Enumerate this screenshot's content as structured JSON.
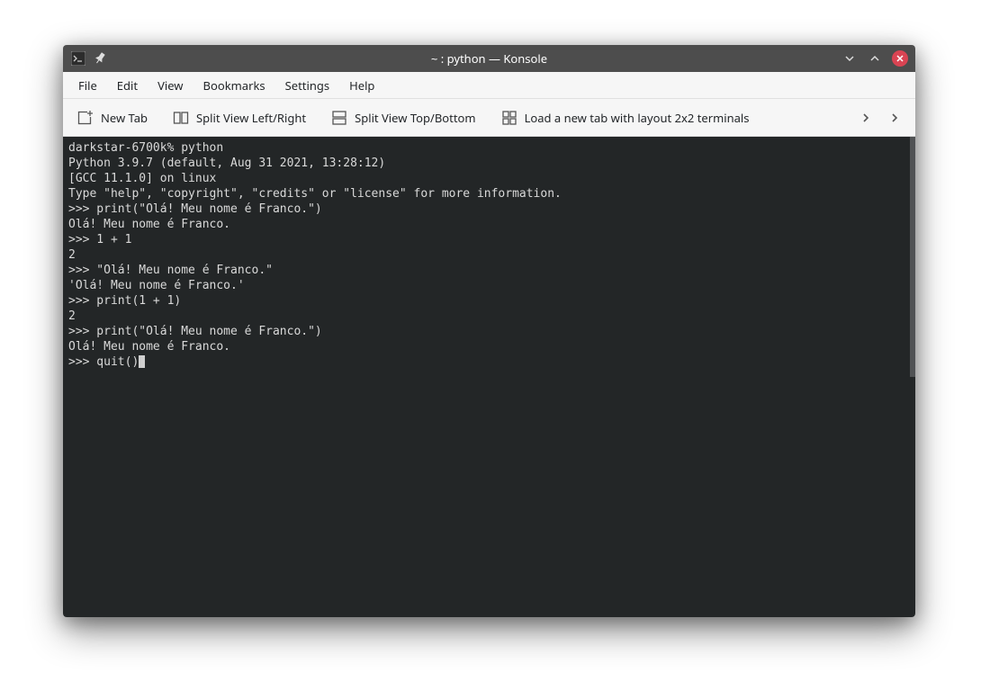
{
  "titlebar": {
    "title": "~ : python — Konsole"
  },
  "menubar": {
    "items": [
      "File",
      "Edit",
      "View",
      "Bookmarks",
      "Settings",
      "Help"
    ]
  },
  "toolbar": {
    "new_tab": "New Tab",
    "split_lr": "Split View Left/Right",
    "split_tb": "Split View Top/Bottom",
    "load_layout": "Load a new tab with layout 2x2 terminals"
  },
  "terminal": {
    "lines": [
      "darkstar-6700k% python",
      "Python 3.9.7 (default, Aug 31 2021, 13:28:12)",
      "[GCC 11.1.0] on linux",
      "Type \"help\", \"copyright\", \"credits\" or \"license\" for more information.",
      ">>> print(\"Olá! Meu nome é Franco.\")",
      "Olá! Meu nome é Franco.",
      ">>> 1 + 1",
      "2",
      ">>> \"Olá! Meu nome é Franco.\"",
      "'Olá! Meu nome é Franco.'",
      ">>> print(1 + 1)",
      "2",
      ">>> print(\"Olá! Meu nome é Franco.\")",
      "Olá! Meu nome é Franco.",
      ">>> quit()"
    ]
  }
}
